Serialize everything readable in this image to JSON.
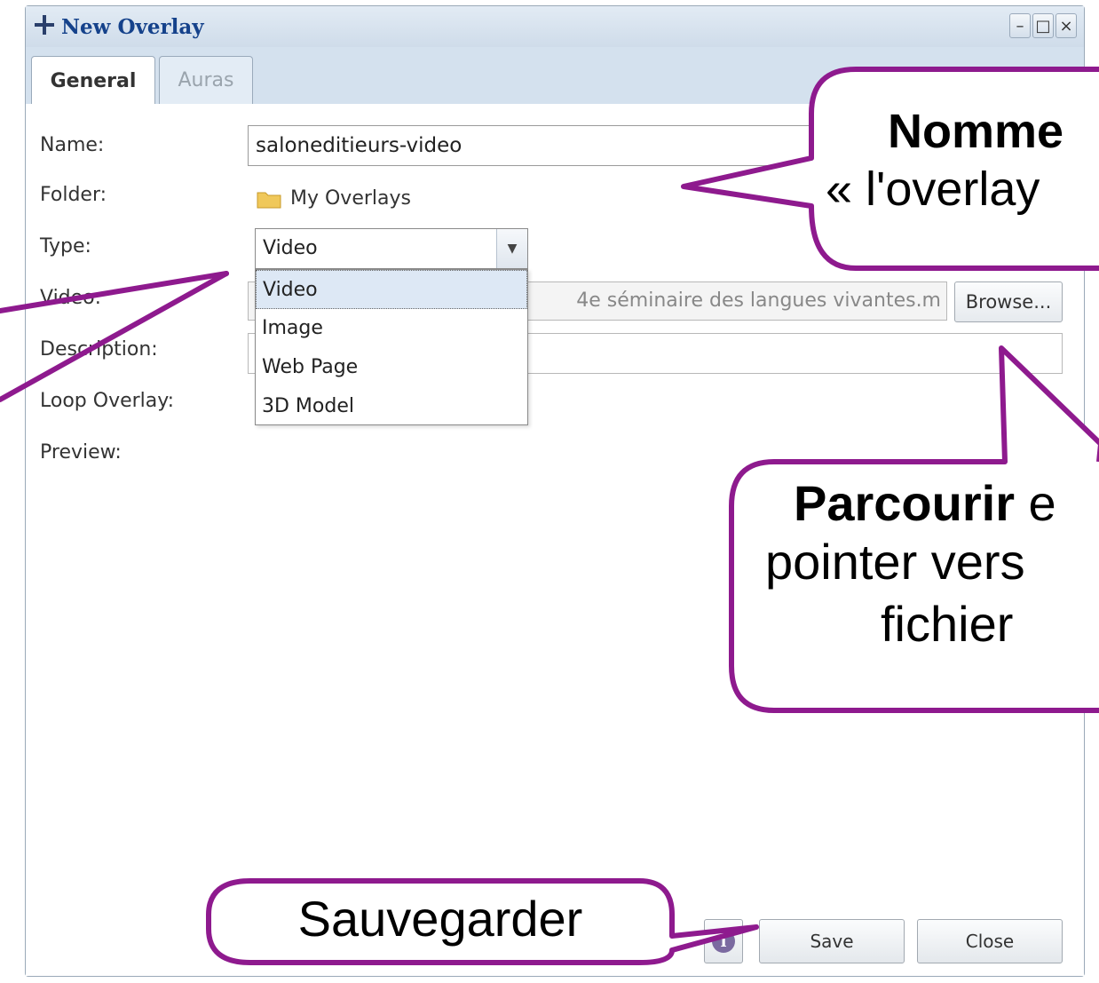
{
  "window": {
    "title": "New Overlay",
    "controls": [
      "–",
      "□",
      "×"
    ]
  },
  "tabs": [
    {
      "label": "General",
      "active": true
    },
    {
      "label": "Auras",
      "active": false
    }
  ],
  "form": {
    "name_label": "Name:",
    "name_value": "saloneditieurs-video",
    "folder_label": "Folder:",
    "folder_value": "My Overlays",
    "type_label": "Type:",
    "type_value": "Video",
    "type_options": [
      "Video",
      "Image",
      "Web Page",
      "3D Model"
    ],
    "video_label": "Video:",
    "video_value": "4e séminaire des langues vivantes.m",
    "browse_label": "Browse...",
    "description_label": "Description:",
    "loop_label": "Loop Overlay:",
    "preview_label": "Preview:"
  },
  "footer": {
    "info_icon": "i",
    "save_label": "Save",
    "close_label": "Close"
  },
  "annotations": {
    "name_callout_bold": "Nomme",
    "name_callout_line2": "« l'overlay",
    "browse_callout_bold": "Parcourir",
    "browse_callout_rest": " e",
    "browse_callout_line2": "pointer vers",
    "browse_callout_line3": "fichier",
    "save_callout": "Sauvegarder",
    "callout_color": "#8e1a8e"
  }
}
